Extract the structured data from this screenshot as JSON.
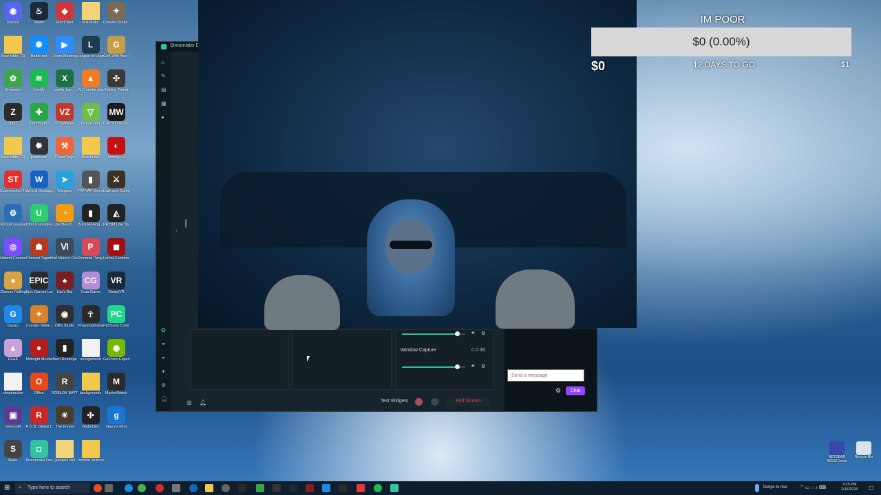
{
  "desktop": {
    "icons": [
      {
        "label": "Discord",
        "color": "#5865f2",
        "glyph": "◉"
      },
      {
        "label": "Steam",
        "color": "#1b2838",
        "glyph": "♨"
      },
      {
        "label": "Riot Client",
        "color": "#d13639",
        "glyph": "◆"
      },
      {
        "label": "textbooks",
        "color": "#f2d37a",
        "glyph": ""
      },
      {
        "label": "Counter-Strike Source",
        "color": "#7b6a55",
        "glyph": "✦"
      },
      {
        "label": "New folder (3)",
        "color": "#f2c94c",
        "glyph": ""
      },
      {
        "label": "Battle.net",
        "color": "#148eff",
        "glyph": "✺"
      },
      {
        "label": "Zoom Meeting",
        "color": "#2d8cff",
        "glyph": "▶"
      },
      {
        "label": "League of Legends",
        "color": "#1e3c50",
        "glyph": "L"
      },
      {
        "label": "Golf With Your Friends",
        "color": "#c79d43",
        "glyph": "G"
      },
      {
        "label": "Grounded",
        "color": "#3aa54b",
        "glyph": "✿"
      },
      {
        "label": "Spotify",
        "color": "#1db954",
        "glyph": "≋"
      },
      {
        "label": "config_bac...",
        "color": "#1e7145",
        "glyph": "X"
      },
      {
        "label": "VLC media player",
        "color": "#f47b20",
        "glyph": "▲"
      },
      {
        "label": "Fishing Planet",
        "color": "#3c3a36",
        "glyph": "✣"
      },
      {
        "label": "DayZ",
        "color": "#2b2b2b",
        "glyph": "Z"
      },
      {
        "label": "PatchMyPC",
        "color": "#28a745",
        "glyph": "✚"
      },
      {
        "label": "VZSoftware",
        "color": "#c0392b",
        "glyph": "VZ"
      },
      {
        "label": "ProtonVPN",
        "color": "#6cc04a",
        "glyph": "▽"
      },
      {
        "label": "Call of Duty Modern...",
        "color": "#1a1a1a",
        "glyph": "MW"
      },
      {
        "label": "New folder (2)",
        "color": "#f2c94c",
        "glyph": ""
      },
      {
        "label": "plutonium",
        "color": "#30343a",
        "glyph": "✹"
      },
      {
        "label": "CurseForge",
        "color": "#f16436",
        "glyph": "⚒"
      },
      {
        "label": "New folder",
        "color": "#f2c94c",
        "glyph": ""
      },
      {
        "label": "Among Us",
        "color": "#c51111",
        "glyph": "◐"
      },
      {
        "label": "Supermarket Together",
        "color": "#e03030",
        "glyph": "ST"
      },
      {
        "label": "Webull Desktop",
        "color": "#1565c0",
        "glyph": "W"
      },
      {
        "label": "Telegram",
        "color": "#2aa1da",
        "glyph": "➤"
      },
      {
        "label": "YAPYAP Demo",
        "color": "#555",
        "glyph": "▮"
      },
      {
        "label": "Dark and Darker A5",
        "color": "#3b3023",
        "glyph": "⚔"
      },
      {
        "label": "Rocket League",
        "color": "#2c6db5",
        "glyph": "⚙"
      },
      {
        "label": "IObit Uninstaller",
        "color": "#2ecc71",
        "glyph": "U"
      },
      {
        "label": "UserBench...",
        "color": "#f39c12",
        "glyph": "◔"
      },
      {
        "label": "Burn Reveng...",
        "color": "#222",
        "glyph": "▮"
      },
      {
        "label": "PRISM Live Studio",
        "color": "#222",
        "glyph": "◭"
      },
      {
        "label": "Ubisoft Connect",
        "color": "#7c4dff",
        "glyph": "◎"
      },
      {
        "label": "Chained Together",
        "color": "#b83a1e",
        "glyph": "☗"
      },
      {
        "label": "Sid Meier's Civilization VI",
        "color": "#3c4a5a",
        "glyph": "Ⅵ"
      },
      {
        "label": "Pummel Party",
        "color": "#d84a5a",
        "glyph": "P"
      },
      {
        "label": "Lethal Company",
        "color": "#a01010",
        "glyph": "◼"
      },
      {
        "label": "Cheese Rolling",
        "color": "#d9a441",
        "glyph": "●"
      },
      {
        "label": "Epic Games Launcher",
        "color": "#2a2a2a",
        "glyph": "EPIC"
      },
      {
        "label": "Liar's Bar",
        "color": "#7a1e1e",
        "glyph": "♠"
      },
      {
        "label": "Crab Game",
        "color": "#b58ad6",
        "glyph": "CG"
      },
      {
        "label": "SteamVR",
        "color": "#1b2838",
        "glyph": "VR"
      },
      {
        "label": "Gyazo",
        "color": "#1e88e5",
        "glyph": "G"
      },
      {
        "label": "Counter-Strike 2",
        "color": "#d9822b",
        "glyph": "✦"
      },
      {
        "label": "OBS Studio",
        "color": "#302e31",
        "glyph": "◉"
      },
      {
        "label": "Phasmophobia",
        "color": "#2a2a2a",
        "glyph": "☥"
      },
      {
        "label": "PyCharm Communi...",
        "color": "#21d789",
        "glyph": "PC"
      },
      {
        "label": "PEAK",
        "color": "#c8a2d6",
        "glyph": "▲"
      },
      {
        "label": "Midnight Murder Club",
        "color": "#b71c1c",
        "glyph": "●"
      },
      {
        "label": "Burn Revenge",
        "color": "#222",
        "glyph": "▮"
      },
      {
        "label": "unorganized",
        "color": "#f2f2f2",
        "glyph": ""
      },
      {
        "label": "GeForce Experience",
        "color": "#76b900",
        "glyph": "◉"
      },
      {
        "label": "sleeptracker",
        "color": "#f2f2f2",
        "glyph": ""
      },
      {
        "label": "Office",
        "color": "#e64a19",
        "glyph": "O"
      },
      {
        "label": "ROBLOX BATTLEGR...",
        "color": "#444",
        "glyph": "R"
      },
      {
        "label": "backgrounds",
        "color": "#f2c94c",
        "glyph": ""
      },
      {
        "label": "MarketWatch",
        "color": "#2b2b2b",
        "glyph": "M"
      },
      {
        "label": "minecraft",
        "color": "#5d3a8f",
        "glyph": "▣"
      },
      {
        "label": "R.O.B. Global Domination",
        "color": "#c62828",
        "glyph": "R"
      },
      {
        "label": "The Forest",
        "color": "#4a3b2a",
        "glyph": "☀"
      },
      {
        "label": "GloboDex",
        "color": "#222",
        "glyph": "✣"
      },
      {
        "label": "Garry's Mod",
        "color": "#1976d2",
        "glyph": "g"
      },
      {
        "label": "Skate.",
        "color": "#444",
        "glyph": "S"
      },
      {
        "label": "Streamlabs Desktop",
        "color": "#31c3a2",
        "glyph": "◘"
      },
      {
        "label": "goodwill shit",
        "color": "#f2d37a",
        "glyph": ""
      },
      {
        "label": "random pictures",
        "color": "#f2c94c",
        "glyph": ""
      }
    ],
    "right_icons": [
      {
        "label": "NETGEAR A6100 Genie",
        "color": "#3949ab"
      },
      {
        "label": "Recycle Bin",
        "color": "#dde3ea"
      }
    ]
  },
  "streamlabs": {
    "title": "Streamlabs D",
    "mixer": {
      "source_label": "Window Capture",
      "source_db": "0.0 dB",
      "slider1_level": 0.87,
      "slider2_level": 0.87
    },
    "chat": {
      "placeholder": "Send a message",
      "chat_button": "Chat"
    },
    "footer": {
      "test_widgets": "Test Widgets",
      "end_stream": "End Stream"
    }
  },
  "overlay": {
    "goal_title": "IM POOR",
    "goal_progress": "$0 (0.00%)",
    "goal_start": "$0",
    "goal_days": "12 DAYS TO GO",
    "goal_end": "$1"
  },
  "taskbar": {
    "search_placeholder": "Type here to search",
    "weather": "Temps to rise",
    "time": "3:25 PM",
    "date": "2/15/2026"
  }
}
